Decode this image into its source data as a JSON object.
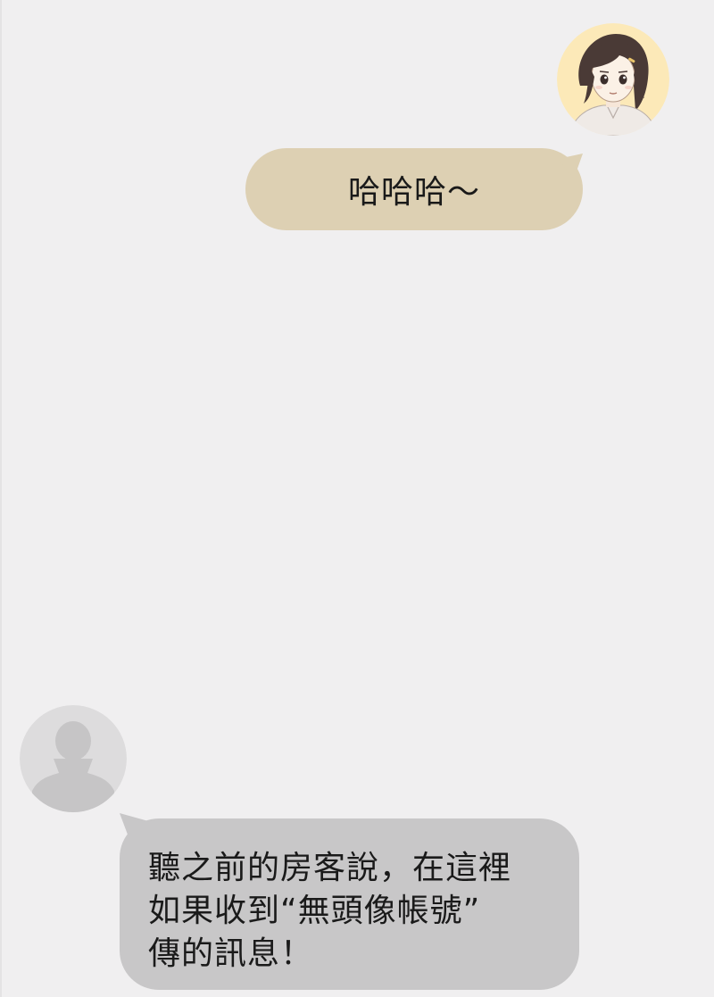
{
  "conversation": {
    "messages": [
      {
        "sender": "self",
        "avatar_icon": "girl-avatar-icon",
        "lines": [
          "哈哈哈～"
        ]
      },
      {
        "sender": "other",
        "avatar_icon": "default-person-avatar-icon",
        "lines": [
          "聽之前的房客說，在這裡",
          "如果收到“無頭像帳號”",
          "傳的訊息！"
        ]
      }
    ]
  },
  "colors": {
    "background": "#f0eff0",
    "self_bubble": "#ddd0b3",
    "other_bubble": "#c8c7c8",
    "avatar_self_bg": "#fce9b8",
    "avatar_blank_bg": "#dddcdd",
    "silhouette": "#c6c5c6"
  }
}
